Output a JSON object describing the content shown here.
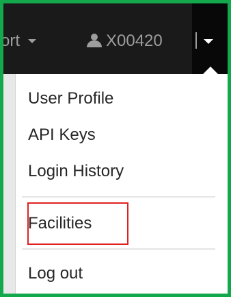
{
  "navbar": {
    "support_label": "ort",
    "user_label": "X00420",
    "icons": {
      "support_caret": "caret-down-icon",
      "user": "user-icon",
      "toggle_caret": "caret-down-icon"
    },
    "colors": {
      "bar": "#1a1a1a",
      "toggle": "#080808",
      "text": "#9d9d9d"
    }
  },
  "dropdown": {
    "items": [
      {
        "label": "User Profile"
      },
      {
        "label": "API Keys"
      },
      {
        "label": "Login History"
      },
      {
        "label": "Facilities"
      },
      {
        "label": "Log out"
      }
    ]
  },
  "colors": {
    "frame_border": "#12a84b",
    "highlight_border": "#e02020",
    "menu_text": "#262626",
    "divider": "#e5e5e5"
  }
}
